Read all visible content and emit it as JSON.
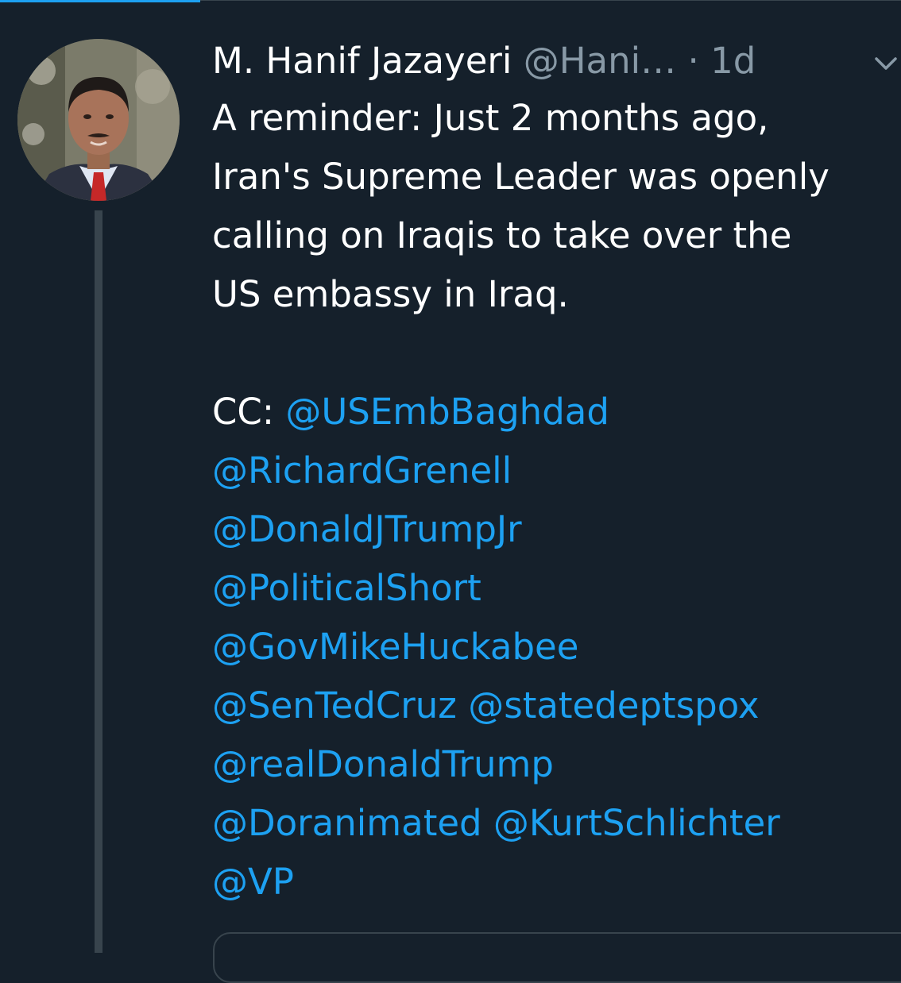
{
  "tweet": {
    "author": {
      "display_name": "M. Hanif Jazayeri",
      "handle": "@Hani…",
      "avatar_icon": "user-photo-avatar"
    },
    "separator": "·",
    "time": "1d",
    "menu_icon": "chevron-down-icon",
    "text_lines": [
      "A reminder: Just 2 months ago,",
      "Iran's Supreme Leader was openly",
      "calling on Iraqis to take over the",
      "US embassy in Iraq."
    ],
    "cc_label": "CC:",
    "mentions": [
      "@USEmbBaghdad",
      "@RichardGrenell",
      "@DonaldJTrumpJr",
      "@PoliticalShort",
      "@GovMikeHuckabee",
      "@SenTedCruz",
      "@statedeptspox",
      "@realDonaldTrump",
      "@Doranimated",
      "@KurtSchlichter",
      "@VP"
    ]
  },
  "colors": {
    "background": "#15202b",
    "text": "#ffffff",
    "muted": "#8899a6",
    "link": "#1da1f2",
    "divider": "#38444d"
  }
}
